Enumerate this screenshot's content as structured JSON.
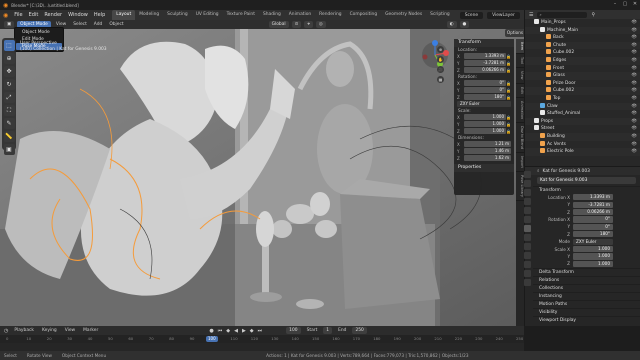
{
  "window": {
    "title": "Blender* [C:\\3D\\...\\untitled.blend]",
    "controls": [
      "minimize-icon",
      "maximize-icon",
      "close-icon"
    ]
  },
  "menu": {
    "items": [
      "File",
      "Edit",
      "Render",
      "Window",
      "Help"
    ],
    "workspaces": [
      "Layout",
      "Modeling",
      "Sculpting",
      "UV Editing",
      "Texture Paint",
      "Shading",
      "Animation",
      "Rendering",
      "Compositing",
      "Geometry Nodes",
      "Scripting"
    ],
    "active_workspace": "Layout",
    "scene": "Scene",
    "view_layer": "ViewLayer"
  },
  "viewport": {
    "mode_button": "Object Mode",
    "header_menus": [
      "View",
      "Select",
      "Add",
      "Object"
    ],
    "orientation": "Global",
    "options_label": "Options",
    "mode_options": [
      "Object Mode",
      "Edit Mode",
      "Pose Mode"
    ],
    "selected_mode": "Pose Mode",
    "info_lines": [
      "User Perspective",
      "(100) Collection | Kat for Genesis 9.003"
    ],
    "side_tabs": [
      "Item",
      "Tool",
      "View",
      "Edit",
      "Animation",
      "Daz to Blend",
      "Import",
      "Pose Library"
    ]
  },
  "transform_panel": {
    "title": "Transform",
    "location_label": "Location:",
    "location": {
      "X": "1.3393 m",
      "Y": "-3.7281 m",
      "Z": "0.06266 m"
    },
    "rotation_label": "Rotation:",
    "rotation": {
      "X": "0°",
      "Y": "0°",
      "Z": "180°"
    },
    "rotation_mode": "ZXY Euler",
    "scale_label": "Scale:",
    "scale": {
      "X": "1.000",
      "Y": "1.000",
      "Z": "1.000"
    },
    "dimensions_label": "Dimensions:",
    "dimensions": {
      "X": "1.21 m",
      "Y": "1.46 m",
      "Z": "1.62 m"
    },
    "properties_label": "Properties"
  },
  "outliner": {
    "search_placeholder": "",
    "rows": [
      {
        "label": "Main_Props",
        "indent": 1,
        "type": "collection"
      },
      {
        "label": "Machine_Main",
        "indent": 2,
        "type": "collection"
      },
      {
        "label": "Back",
        "indent": 3,
        "type": "mesh"
      },
      {
        "label": "Chute",
        "indent": 3,
        "type": "mesh"
      },
      {
        "label": "Cube.002",
        "indent": 3,
        "type": "mesh"
      },
      {
        "label": "Edges",
        "indent": 3,
        "type": "mesh"
      },
      {
        "label": "Front",
        "indent": 3,
        "type": "mesh"
      },
      {
        "label": "Glass",
        "indent": 3,
        "type": "mesh"
      },
      {
        "label": "Prize Door",
        "indent": 3,
        "type": "mesh"
      },
      {
        "label": "Cube.002",
        "indent": 3,
        "type": "mesh"
      },
      {
        "label": "Top",
        "indent": 3,
        "type": "mesh"
      },
      {
        "label": "Claw",
        "indent": 2,
        "type": "armature"
      },
      {
        "label": "Stuffed_Animal",
        "indent": 2,
        "type": "collection"
      },
      {
        "label": "Props",
        "indent": 1,
        "type": "collection"
      },
      {
        "label": "Street",
        "indent": 1,
        "type": "collection"
      },
      {
        "label": "Building",
        "indent": 2,
        "type": "mesh"
      },
      {
        "label": "Ac Vents",
        "indent": 2,
        "type": "mesh"
      },
      {
        "label": "Electric Pole",
        "indent": 2,
        "type": "mesh"
      }
    ],
    "selected_index": -1
  },
  "properties": {
    "object_name": "Kat for Genesis 9.003",
    "header_name": "Kat for Genesis 9.003",
    "transform_title": "Transform",
    "location": {
      "label": "Location X",
      "X": "1.3393 m",
      "Y": "-3.7281 m",
      "Z": "0.06266 m"
    },
    "rotation": {
      "label": "Rotation X",
      "X": "0°",
      "Y": "0°",
      "Z": "180°"
    },
    "mode_label": "Mode",
    "mode_value": "ZXY Euler",
    "scale": {
      "label": "Scale X",
      "X": "1.000",
      "Y": "1.000",
      "Z": "1.000"
    },
    "sections": [
      "Delta Transform",
      "Relations",
      "Collections",
      "Instancing",
      "Motion Paths",
      "Visibility",
      "Viewport Display"
    ]
  },
  "timeline": {
    "menus": [
      "Playback",
      "Keying",
      "View",
      "Marker"
    ],
    "current_frame": "100",
    "start_label": "Start",
    "start": "1",
    "end_label": "End",
    "end": "250",
    "ticks": [
      "0",
      "10",
      "20",
      "30",
      "40",
      "50",
      "60",
      "70",
      "80",
      "90",
      "100",
      "110",
      "120",
      "130",
      "140",
      "150",
      "160",
      "170",
      "180",
      "190",
      "200",
      "210",
      "220",
      "230",
      "240",
      "250"
    ]
  },
  "statusbar": {
    "items": [
      "Select",
      "Rotate View",
      "Object Context Menu"
    ],
    "stats": "Actions: 1 | Kat for Genesis 9.003 | Verts:789,664 | Faces:779,073 | Tris:1,570,862 | Objects:1/23"
  },
  "colors": {
    "accent": "#4772b3",
    "panel": "#262626",
    "viewport_bg": "#7a7a7a",
    "selection_outline": "#f59b3a"
  }
}
